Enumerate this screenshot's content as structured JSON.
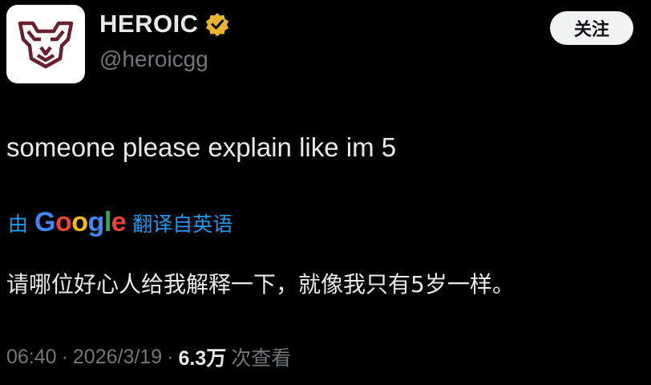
{
  "author": {
    "display_name": "HEROIC",
    "handle": "@heroicgg",
    "verified_color": "#e8b530",
    "avatar_icon": "heroic-wolf-logo-icon"
  },
  "follow_button": {
    "label": "关注"
  },
  "tweet": {
    "text": "someone please explain like im 5"
  },
  "translation": {
    "prefix": "由",
    "provider": {
      "letters": [
        "G",
        "o",
        "o",
        "g",
        "l",
        "e"
      ],
      "colors": [
        "#4285F4",
        "#EA4335",
        "#FBBC05",
        "#4285F4",
        "#34A853",
        "#EA4335"
      ]
    },
    "suffix": "翻译自英语",
    "text": "请哪位好心人给我解释一下，就像我只有5岁一样。"
  },
  "meta": {
    "time": "06:40",
    "separator_1": "·",
    "date": "2026/3/19",
    "separator_2": "·",
    "views_count": "6.3万",
    "views_label": "次查看"
  },
  "colors": {
    "background": "#000000",
    "text_primary": "#e7e9ea",
    "text_secondary": "#71767b",
    "link_blue": "#1d9bf0",
    "avatar_accent": "#6b1f2e"
  }
}
